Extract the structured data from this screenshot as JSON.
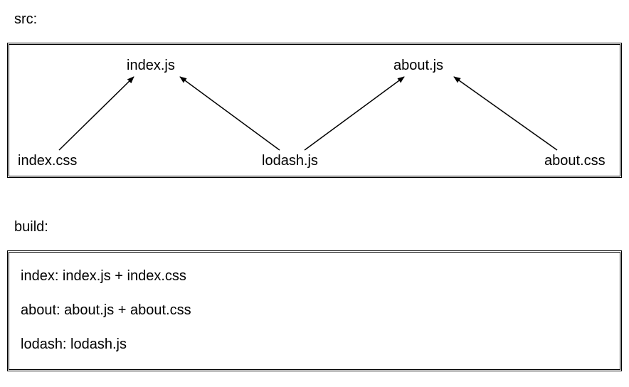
{
  "labels": {
    "src": "src:",
    "build": "build:"
  },
  "src": {
    "top": {
      "index_js": "index.js",
      "about_js": "about.js"
    },
    "bottom": {
      "index_css": "index.css",
      "lodash_js": "lodash.js",
      "about_css": "about.css"
    },
    "edges": [
      {
        "from": "index.css",
        "to": "index.js"
      },
      {
        "from": "lodash.js",
        "to": "index.js"
      },
      {
        "from": "lodash.js",
        "to": "about.js"
      },
      {
        "from": "about.css",
        "to": "about.js"
      }
    ]
  },
  "build": {
    "lines": [
      "index: index.js + index.css",
      "about: about.js + about.css",
      "lodash: lodash.js"
    ]
  },
  "chart_data": {
    "type": "diagram",
    "title": "",
    "panels": [
      {
        "label": "src",
        "nodes_top": [
          "index.js",
          "about.js"
        ],
        "nodes_bottom": [
          "index.css",
          "lodash.js",
          "about.css"
        ],
        "edges": [
          [
            "index.css",
            "index.js"
          ],
          [
            "lodash.js",
            "index.js"
          ],
          [
            "lodash.js",
            "about.js"
          ],
          [
            "about.css",
            "about.js"
          ]
        ]
      },
      {
        "label": "build",
        "bundles": [
          {
            "name": "index",
            "contents": [
              "index.js",
              "index.css"
            ]
          },
          {
            "name": "about",
            "contents": [
              "about.js",
              "about.css"
            ]
          },
          {
            "name": "lodash",
            "contents": [
              "lodash.js"
            ]
          }
        ]
      }
    ]
  }
}
